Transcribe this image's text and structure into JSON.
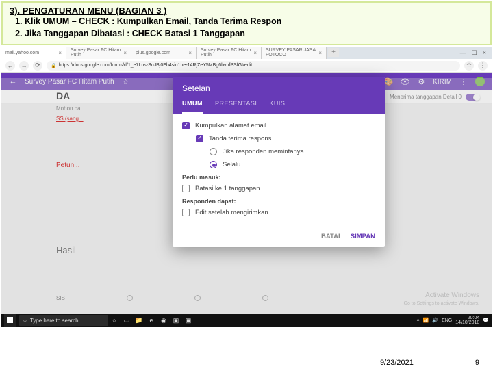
{
  "instruction": {
    "title": "3). PENGATURAN  MENU (BAGIAN 3 )",
    "items": [
      "Klik UMUM – CHECK : Kumpulkan Email, Tanda Terima Respon",
      "Jika  Tanggapan Dibatasi : CHECK Batasi 1 Tanggapan"
    ]
  },
  "browser": {
    "tabs": [
      "mail.yahoo.com",
      "Survey Pasar FC Hitam Putih",
      "plus.google.com",
      "Survey Pasar FC Hitam Putih",
      "SURVEY PASAR JASA FOTOCO"
    ],
    "url": "https://docs.google.com/forms/d/1_e7Lns-SoJBj0Eb4siu1he-14RjZeY5MBg6bvnfPSfGI/edit"
  },
  "forms": {
    "back": "←",
    "title": "Survey Pasar FC Hitam Putih",
    "send": "KIRIM",
    "subbar": "Menerima tanggapan Detail  0"
  },
  "doc": {
    "h": "DA",
    "l1": "Mohon ba...",
    "l2": "SS (sang...",
    "petun": "Petun...",
    "hasil": "Hasil",
    "sis": "SIS"
  },
  "modal": {
    "title": "Setelan",
    "tabs": {
      "umum": "UMUM",
      "presentasi": "PRESENTASI",
      "kuis": "KUIS"
    },
    "opt1": "Kumpulkan alamat email",
    "opt2": "Tanda terima respons",
    "opt2a": "Jika responden memintanya",
    "opt2b": "Selalu",
    "sec1": "Perlu masuk:",
    "opt3": "Batasi ke 1 tanggapan",
    "sec2": "Responden dapat:",
    "opt4": "Edit setelah mengirimkan",
    "batal": "BATAL",
    "simpan": "SIMPAN"
  },
  "taskbar": {
    "search": "Type here to search",
    "lang": "ENG",
    "time": "20:04",
    "date": "14/10/2018"
  },
  "watermark": {
    "l1": "Activate Windows",
    "l2": "Go to Settings to activate Windows."
  },
  "footer": {
    "date": "9/23/2021",
    "page": "9"
  }
}
